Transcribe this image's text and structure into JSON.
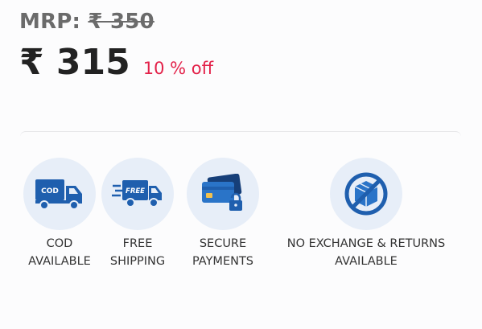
{
  "price": {
    "mrp_label": "MRP:",
    "mrp_value": "₹ 350",
    "current": "₹ 315",
    "discount": "10 % off"
  },
  "features": [
    {
      "icon": "cod-truck-icon",
      "line1": "COD",
      "line2": "AVAILABLE",
      "icon_text": "COD"
    },
    {
      "icon": "free-shipping-truck-icon",
      "line1": "FREE",
      "line2": "SHIPPING",
      "icon_text": "FREE"
    },
    {
      "icon": "secure-payment-card-icon",
      "line1": "SECURE",
      "line2": "PAYMENTS"
    },
    {
      "icon": "no-exchange-box-icon",
      "line1": "NO EXCHANGE & RETURNS",
      "line2": "AVAILABLE"
    }
  ],
  "colors": {
    "accent_blue": "#1f5fae",
    "discount_red": "#e3224a",
    "circle_bg": "#e7eef8"
  }
}
